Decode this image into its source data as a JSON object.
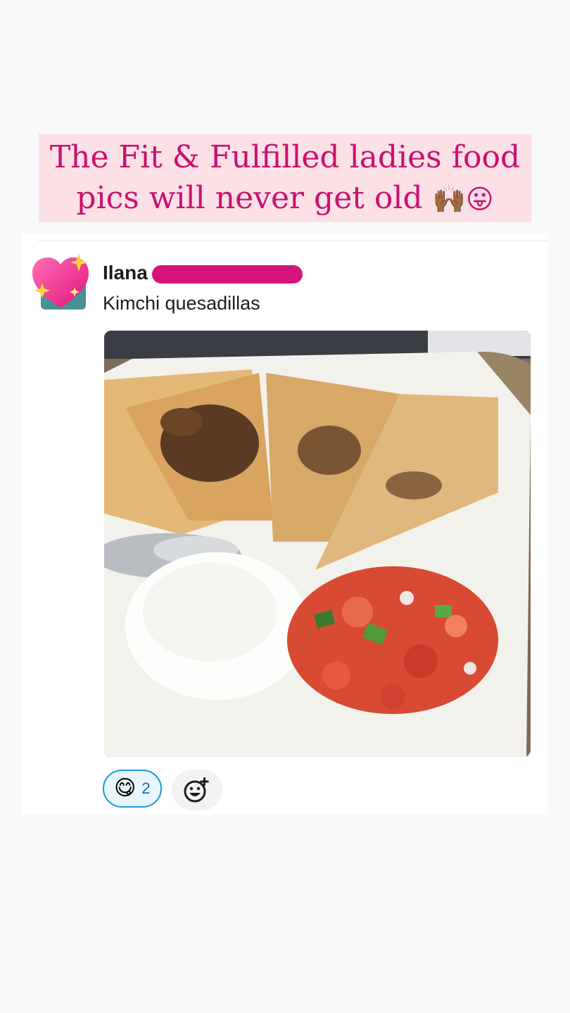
{
  "caption": {
    "line1": "The Fit & Fulfilled ladies food",
    "line2": "pics will never get old",
    "emojis": "🙌🏾😛"
  },
  "message": {
    "author": "Ilana",
    "text": "Kimchi quesadillas",
    "avatar_icon": "sparkling-heart"
  },
  "photo": {
    "subject": "quesadillas with sour cream and pico de gallo"
  },
  "reactions": [
    {
      "emoji": "😋",
      "count": "2"
    }
  ],
  "add_reaction_icon": "add-reaction-smiley",
  "colors": {
    "caption_bg": "#fbe0e6",
    "caption_text": "#c8126e",
    "redaction": "#d4147a",
    "reaction_border": "#1d9bd1"
  }
}
